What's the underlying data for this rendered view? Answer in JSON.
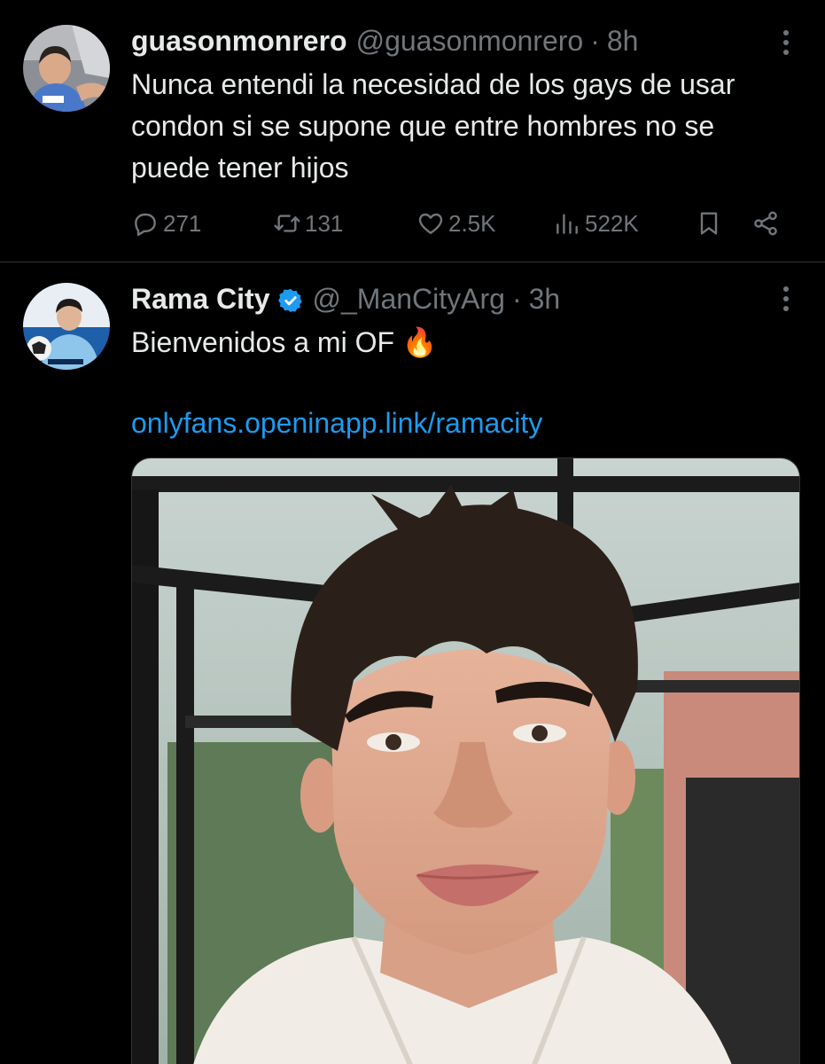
{
  "tweets": [
    {
      "name": "guasonmonrero",
      "handle": "@guasonmonrero",
      "separator": "·",
      "time": "8h",
      "text": "Nunca entendi la necesidad de los gays de usar condon si se supone que entre hombres no se puede tener hijos",
      "verified": false,
      "stats": {
        "replies": "271",
        "retweets": "131",
        "likes": "2.5K",
        "views": "522K"
      }
    },
    {
      "name": "Rama City",
      "handle": "@_ManCityArg",
      "separator": "·",
      "time": "3h",
      "text": "Bienvenidos a mi OF 🔥",
      "link": "onlyfans.openinapp.link/ramacity",
      "verified": true,
      "media": "photo"
    }
  ],
  "colors": {
    "background": "#000000",
    "text": "#e7e9ea",
    "muted": "#71767b",
    "link": "#1d9bf0",
    "verified": "#1d9bf0",
    "divider": "#2f3336"
  },
  "icons": [
    "reply-icon",
    "retweet-icon",
    "like-icon",
    "views-icon",
    "bookmark-icon",
    "share-icon",
    "more-icon",
    "verified-badge-icon"
  ]
}
